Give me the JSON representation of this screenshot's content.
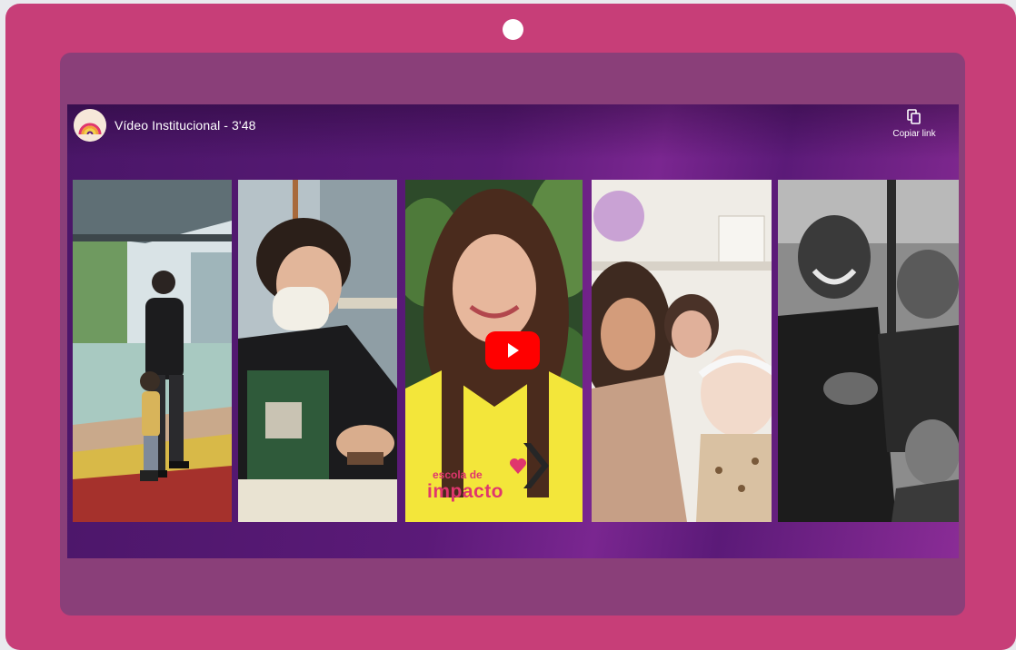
{
  "player": {
    "title": "Vídeo Institucional - 3'48",
    "copy_link_label": "Copiar link",
    "channel_logo": "rainbow-logo-icon",
    "play_button_icon": "play-icon",
    "copy_icon": "copy-icon"
  },
  "thumbnail": {
    "shirt_text_line1": "escola de",
    "shirt_text_line2": "impacto"
  },
  "colors": {
    "device_frame": "#c73e78",
    "screen_bezel": "#8a3f79",
    "player_background": "#5b1a78",
    "play_button": "#ff0000"
  }
}
